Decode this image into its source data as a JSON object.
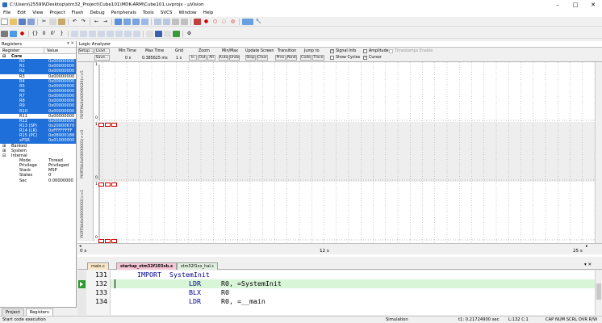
{
  "window": {
    "title": "C:\\Users\\25599\\Desktop\\stm32_Project\\Cube101\\MDK-ARM\\Cube101.uvprojx - µVision",
    "min": "–",
    "max": "□",
    "close": "✕"
  },
  "menu": [
    "File",
    "Edit",
    "View",
    "Project",
    "Flash",
    "Debug",
    "Peripherals",
    "Tools",
    "SVCS",
    "Window",
    "Help"
  ],
  "registers": {
    "pane_title": "Registers",
    "col_register": "Register",
    "col_value": "Value",
    "core_label": "Core",
    "rows": [
      {
        "name": "R0",
        "value": "0x00000000",
        "sel": true
      },
      {
        "name": "R1",
        "value": "0x00000000",
        "sel": true
      },
      {
        "name": "R2",
        "value": "0x00000000",
        "sel": true
      },
      {
        "name": "R3",
        "value": "0x00000000",
        "sel": false
      },
      {
        "name": "R4",
        "value": "0x00000000",
        "sel": true
      },
      {
        "name": "R5",
        "value": "0x00000000",
        "sel": true
      },
      {
        "name": "R6",
        "value": "0x00000000",
        "sel": true
      },
      {
        "name": "R7",
        "value": "0x00000000",
        "sel": true
      },
      {
        "name": "R8",
        "value": "0x00000000",
        "sel": true
      },
      {
        "name": "R9",
        "value": "0x00000000",
        "sel": true
      },
      {
        "name": "R10",
        "value": "0x00000000",
        "sel": true
      },
      {
        "name": "R11",
        "value": "0x00000000",
        "sel": false
      },
      {
        "name": "R12",
        "value": "0x00000000",
        "sel": true
      },
      {
        "name": "R13 (SP)",
        "value": "0x20000670",
        "sel": true
      },
      {
        "name": "R14 (LR)",
        "value": "0xFFFFFFFF",
        "sel": true
      },
      {
        "name": "R15 (PC)",
        "value": "0x08000188",
        "sel": true
      },
      {
        "name": "xPSR",
        "value": "0x01000000",
        "sel": true
      }
    ],
    "groups": [
      "Banked",
      "System",
      "Internal"
    ],
    "internal": [
      {
        "name": "Mode",
        "value": "Thread"
      },
      {
        "name": "Privilege",
        "value": "Privileged"
      },
      {
        "name": "Stack",
        "value": "MSP"
      },
      {
        "name": "States",
        "value": "0"
      },
      {
        "name": "Sec",
        "value": "0.00000000"
      }
    ],
    "tab_project": "Project",
    "tab_registers": "Registers"
  },
  "logic_analyzer": {
    "title": "Logic Analyzer",
    "setup": "Setup...",
    "load": "Load...",
    "save": "Save...",
    "min_time_label": "Min Time",
    "min_time": "0 s",
    "max_time_label": "Max Time",
    "max_time": "0.385625 ms",
    "grid_label": "Grid",
    "grid": "1 s",
    "zoom_label": "Zoom",
    "zoom_in": "In",
    "zoom_out": "Out",
    "zoom_all": "All",
    "minmax_label": "Min/Max",
    "auto": "Auto",
    "undo": "Undo",
    "update_label": "Update Screen",
    "stop": "Stop",
    "clear": "Clear",
    "transition_label": "Transition",
    "prev": "Prev",
    "next": "Next",
    "jump_label": "Jump to",
    "code": "Code",
    "trace": "Trace",
    "signal_info": "Signal Info",
    "show_cycles": "Show Cycles",
    "amplitude": "Amplitude",
    "cursor": "Cursor",
    "timestamps": "Timestamps Enable",
    "signals": [
      "PORTA&0x00000020)>>5",
      "PORTB&0x00000001)>>0",
      "PORTB&0x00000002)>>1"
    ],
    "y_one": "1",
    "y_zero": "0",
    "axis_left": "0 s",
    "axis_mid": "12 s",
    "axis_right": "25 s"
  },
  "editor": {
    "tabs": [
      "main.c",
      "startup_stm32f103xb.s",
      "stm32f1xx_hal.c"
    ],
    "lines": [
      {
        "n": "131",
        "code": "IMPORT  SystemInit"
      },
      {
        "n": "132",
        "code": "LDR     R0, =SystemInit"
      },
      {
        "n": "133",
        "code": "BLX     R0"
      },
      {
        "n": "134",
        "code": "LDR     R0, =__main"
      }
    ]
  },
  "status": {
    "left": "Start code execution",
    "mode": "Simulation",
    "time": "t1: 0.21724900 sec",
    "pos": "L:132 C:1",
    "keys": "CAP  NUM  SCRL  OVR  R/W"
  },
  "colors": {
    "selection": "#1e6fd9",
    "current_line": "#d8f5d8",
    "keyword": "#00008b"
  }
}
